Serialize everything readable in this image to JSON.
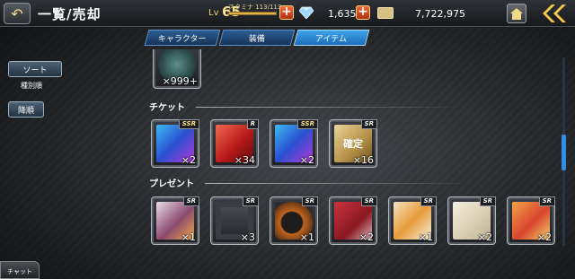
{
  "header": {
    "title": "一覧/売却",
    "level_label": "Lv",
    "level_value": "65",
    "stamina_label": "スタミナ 113/113",
    "stamina_fraction": 1.0,
    "gems": "1,635",
    "money": "7,722,975",
    "back_icon": "back-arrow-icon",
    "home_icon": "home-icon",
    "collapse_icon": "double-chevron-left-icon",
    "accent_color": "#f0d470"
  },
  "tabs": [
    {
      "label": "キャラクター",
      "active": false
    },
    {
      "label": "装備",
      "active": false
    },
    {
      "label": "アイテム",
      "active": true
    }
  ],
  "sidebar": {
    "sort_label": "ソート",
    "sort_value": "種別順",
    "order_label": "降順"
  },
  "sections": {
    "top_item_count": "×999+",
    "ticket_label": "チケット",
    "present_label": "プレゼント",
    "tickets": [
      {
        "rarity": "SSR",
        "count": "×2"
      },
      {
        "rarity": "R",
        "count": "×34"
      },
      {
        "rarity": "SSR",
        "count": "×2"
      },
      {
        "rarity": "SR",
        "count": "×16",
        "art_text": "確定"
      }
    ],
    "presents": [
      {
        "rarity": "SR",
        "count": "×1"
      },
      {
        "rarity": "SR",
        "count": "×3"
      },
      {
        "rarity": "SR",
        "count": "×1"
      },
      {
        "rarity": "SR",
        "count": "×2"
      },
      {
        "rarity": "SR",
        "count": "×1"
      },
      {
        "rarity": "SR",
        "count": "×2"
      },
      {
        "rarity": "SR",
        "count": "×2"
      }
    ]
  },
  "chat": {
    "label": "チャット"
  }
}
